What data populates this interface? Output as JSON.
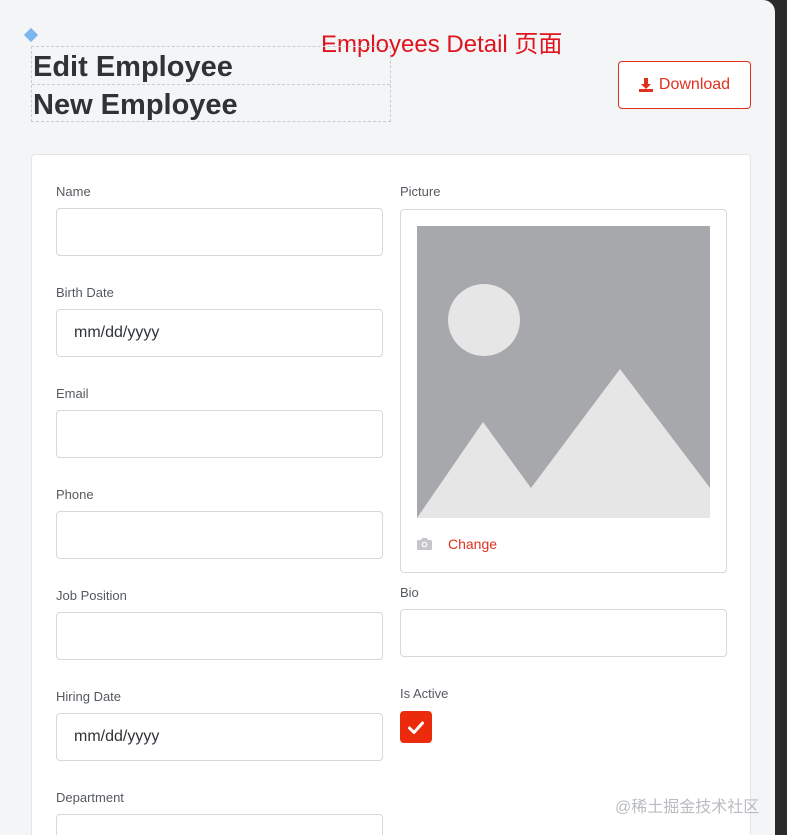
{
  "annotation": {
    "title": "Employees  Detail 页面"
  },
  "header": {
    "titles": [
      "Edit Employee",
      "New Employee"
    ],
    "download_label": "Download"
  },
  "form": {
    "name": {
      "label": "Name",
      "value": ""
    },
    "birth_date": {
      "label": "Birth Date",
      "value": "mm/dd/yyyy"
    },
    "email": {
      "label": "Email",
      "value": ""
    },
    "phone": {
      "label": "Phone",
      "value": ""
    },
    "job_position": {
      "label": "Job Position",
      "value": ""
    },
    "hiring_date": {
      "label": "Hiring Date",
      "value": "mm/dd/yyyy"
    },
    "department": {
      "label": "Department",
      "value": ""
    },
    "picture": {
      "label": "Picture",
      "change_label": "Change"
    },
    "bio": {
      "label": "Bio",
      "value": ""
    },
    "is_active": {
      "label": "Is Active",
      "checked": true
    }
  },
  "watermark": "@稀土掘金技术社区",
  "colors": {
    "accent": "#e0311f",
    "checkbox": "#ec2b0c",
    "annotation": "#e0141e",
    "placeholder_bg": "#a7a8ab",
    "placeholder_fg": "#e6e6e6"
  }
}
